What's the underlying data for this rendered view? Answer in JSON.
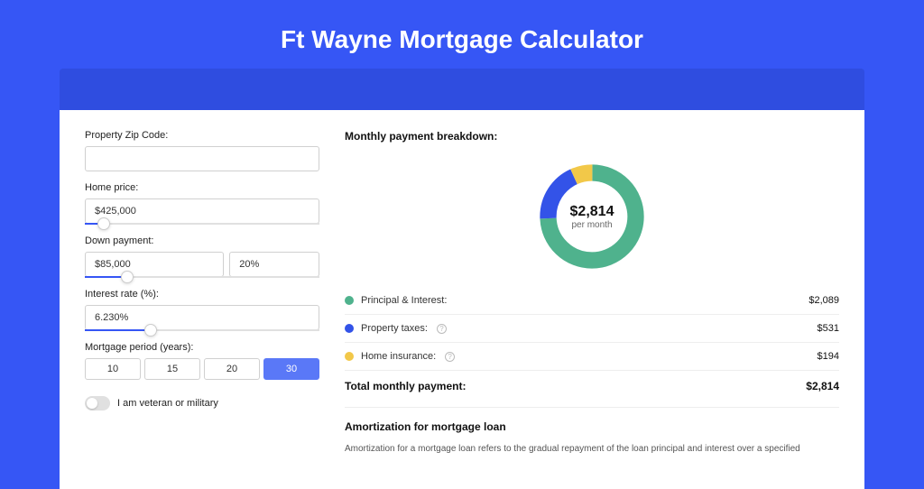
{
  "title": "Ft Wayne Mortgage Calculator",
  "fields": {
    "zip_label": "Property Zip Code:",
    "zip_value": "",
    "home_price_label": "Home price:",
    "home_price_value": "$425,000",
    "down_payment_label": "Down payment:",
    "down_payment_amount": "$85,000",
    "down_payment_pct": "20%",
    "interest_label": "Interest rate (%):",
    "interest_value": "6.230%",
    "period_label": "Mortgage period (years):",
    "period_options": [
      "10",
      "15",
      "20",
      "30"
    ],
    "period_active": "30",
    "veteran_label": "I am veteran or military"
  },
  "sliders": {
    "home_price_pct": 8,
    "down_payment_pct": 18,
    "interest_pct": 28
  },
  "breakdown": {
    "title": "Monthly payment breakdown:",
    "center_amount": "$2,814",
    "center_sub": "per month",
    "items": [
      {
        "label": "Principal & Interest:",
        "value": "$2,089",
        "color": "#4fb28d",
        "info": false
      },
      {
        "label": "Property taxes:",
        "value": "$531",
        "color": "#3353e8",
        "info": true
      },
      {
        "label": "Home insurance:",
        "value": "$194",
        "color": "#f2c849",
        "info": true
      }
    ],
    "total_label": "Total monthly payment:",
    "total_value": "$2,814"
  },
  "amortization": {
    "title": "Amortization for mortgage loan",
    "text": "Amortization for a mortgage loan refers to the gradual repayment of the loan principal and interest over a specified"
  },
  "chart_data": {
    "type": "pie",
    "title": "Monthly payment breakdown",
    "series": [
      {
        "name": "Principal & Interest",
        "value": 2089,
        "color": "#4fb28d"
      },
      {
        "name": "Property taxes",
        "value": 531,
        "color": "#3353e8"
      },
      {
        "name": "Home insurance",
        "value": 194,
        "color": "#f2c849"
      }
    ],
    "total": 2814
  }
}
